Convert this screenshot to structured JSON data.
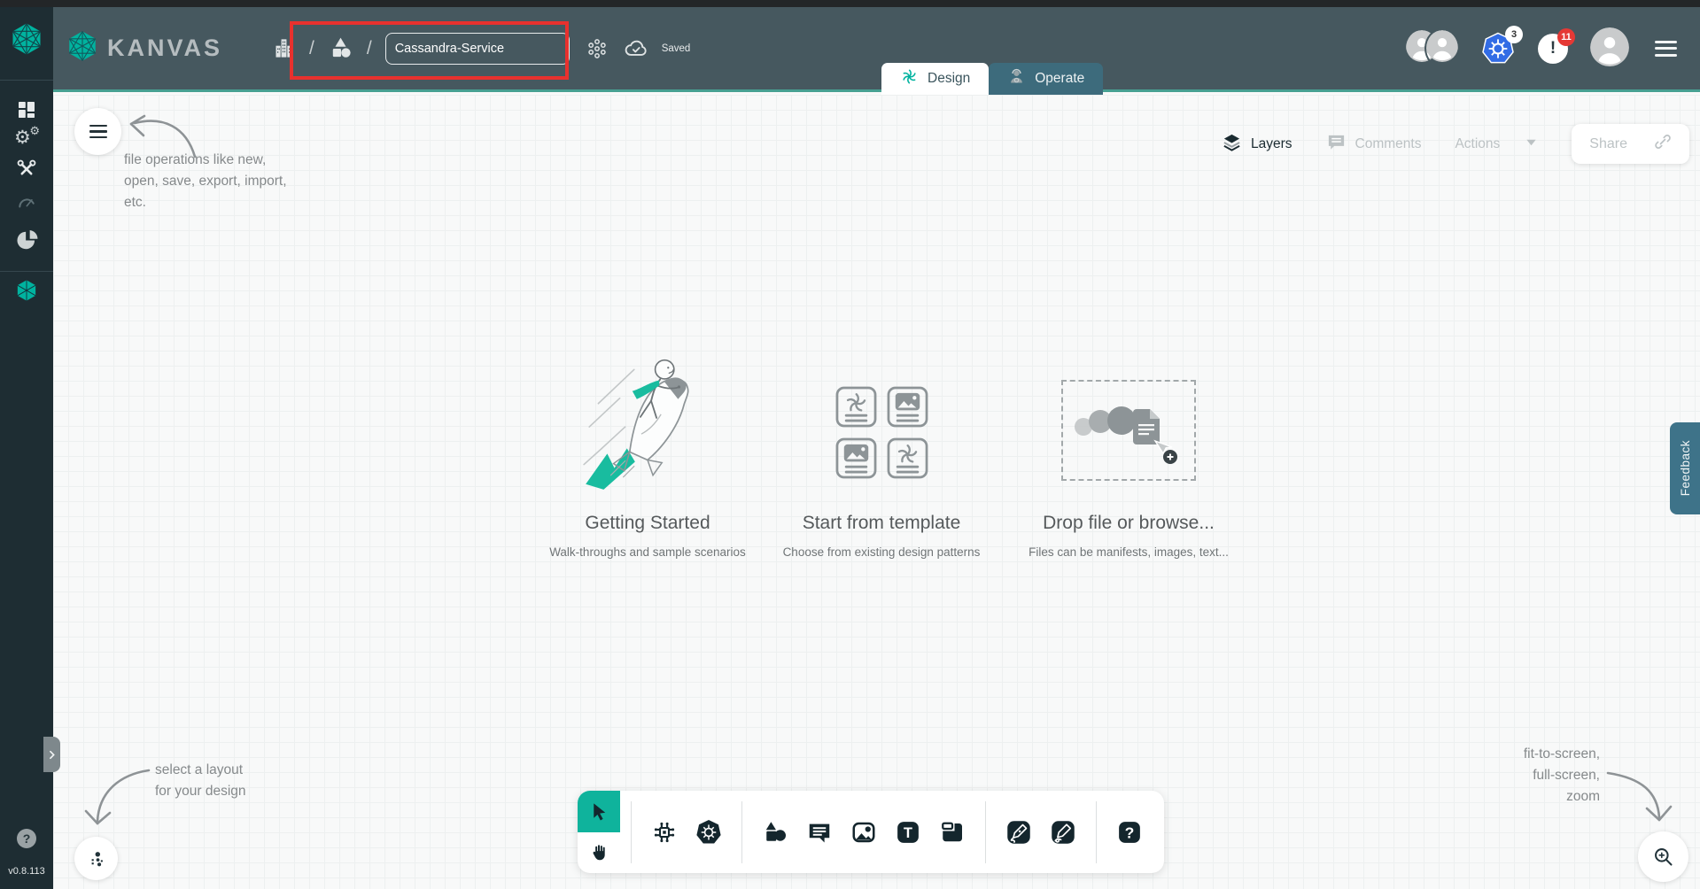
{
  "app": {
    "brand": "KANVAS",
    "version": "v0.8.113"
  },
  "header": {
    "breadcrumb_separator": "/",
    "design_name": "Cassandra-Service",
    "saved_label": "Saved",
    "k8s_context_badge": "3",
    "alert_badge": "11"
  },
  "tabs": {
    "design": "Design",
    "operate": "Operate"
  },
  "canvas_bar": {
    "layers": "Layers",
    "comments": "Comments",
    "actions": "Actions",
    "share": "Share"
  },
  "cards": [
    {
      "title": "Getting Started",
      "subtitle": "Walk-throughs and sample scenarios"
    },
    {
      "title": "Start from template",
      "subtitle": "Choose from existing design patterns"
    },
    {
      "title": "Drop file or browse...",
      "subtitle": "Files can be manifests, images, text..."
    }
  ],
  "annotations": {
    "file_ops": [
      "file operations like new,",
      "open, save, export, import,",
      "etc."
    ],
    "layout": [
      "select a layout",
      "for your design"
    ],
    "view": [
      "fit-to-screen,",
      "full-screen,",
      "zoom"
    ]
  },
  "feedback_label": "Feedback",
  "glyphs": {
    "gear": "⚙",
    "help": "?",
    "alert": "!",
    "text_tool": "T"
  },
  "icons": {
    "menu": "hamburger ≡",
    "layers": "stacked-layers",
    "comments": "speech-bubble",
    "share": "chain-link",
    "kubernetes": "k8s-wheel ☸",
    "cloud_saved": "cloud-check",
    "cluster": "node-flower",
    "building": "organization",
    "shapes": "triangle-square-circle",
    "select": "cursor-arrow",
    "pan": "hand",
    "zoom": "magnifier-plus"
  },
  "colors": {
    "accent": "#00B39F",
    "header_bg": "#46585F",
    "sidebar_bg": "#1E2D33",
    "operate_tab_bg": "#3D6B7C",
    "feedback_bg": "#3E7389",
    "highlight_red": "#E8312E",
    "k8s_blue": "#326CE5",
    "badge_red": "#E53935"
  }
}
